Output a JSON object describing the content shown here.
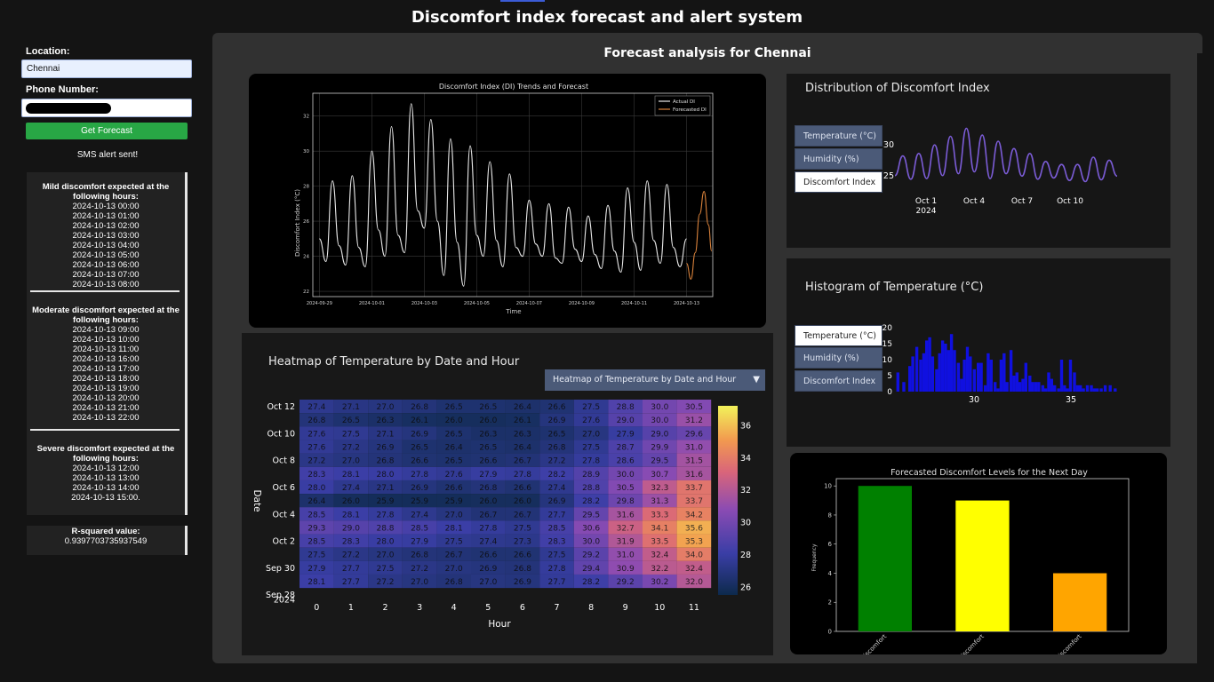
{
  "app_title": "Discomfort index forecast and alert system",
  "sidebar": {
    "location_label": "Location:",
    "location_value": "Chennai",
    "phone_label": "Phone Number:",
    "get_button": "Get Forecast",
    "sms_status": "SMS alert sent!"
  },
  "alerts": [
    {
      "header": "Mild discomfort expected at the following hours:",
      "times": [
        "2024-10-13 00:00",
        "2024-10-13 01:00",
        "2024-10-13 02:00",
        "2024-10-13 03:00",
        "2024-10-13 04:00",
        "2024-10-13 05:00",
        "2024-10-13 06:00",
        "2024-10-13 07:00",
        "2024-10-13 08:00"
      ]
    },
    {
      "header": "Moderate discomfort expected at the following hours:",
      "times": [
        "2024-10-13 09:00",
        "2024-10-13 10:00",
        "2024-10-13 11:00",
        "2024-10-13 16:00",
        "2024-10-13 17:00",
        "2024-10-13 18:00",
        "2024-10-13 19:00",
        "2024-10-13 20:00",
        "2024-10-13 21:00",
        "2024-10-13 22:00"
      ]
    },
    {
      "header": "Severe discomfort expected at the following hours:",
      "times": [
        "2024-10-13 12:00",
        "2024-10-13 13:00",
        "2024-10-13 14:00",
        "2024-10-13 15:00."
      ]
    }
  ],
  "rsquared": {
    "label": "R-squared value:",
    "value": "0.9397703735937549"
  },
  "main": {
    "title": "Forecast analysis for Chennai"
  },
  "line_chart": {
    "title": "Discomfort Index (DI) Trends and Forecast",
    "xlabel": "Time",
    "ylabel": "Discomfort Index (°C)",
    "legend": [
      "Actual DI",
      "Forecasted DI"
    ],
    "x_ticks": [
      "2024-09-29",
      "2024-10-01",
      "2024-10-03",
      "2024-10-05",
      "2024-10-07",
      "2024-10-09",
      "2024-10-11",
      "2024-10-13"
    ],
    "y_ticks": [
      "22",
      "24",
      "26",
      "28",
      "30",
      "32"
    ],
    "colors": {
      "actual": "#e8e8e8",
      "forecast": "#d9823b"
    }
  },
  "distribution": {
    "title": "Distribution of Discomfort Index",
    "tabs": [
      "Temperature (°C)",
      "Humidity (%)",
      "Discomfort Index"
    ],
    "active_tab": 2,
    "x_ticks": [
      "Oct 1",
      "Oct 4",
      "Oct 7",
      "Oct 10"
    ],
    "x_year": "2024",
    "y_ticks": [
      "30",
      "25"
    ],
    "line_color": "#7b5cd6"
  },
  "histogram": {
    "title": "Histogram of Temperature (°C)",
    "tabs": [
      "Temperature (°C)",
      "Humidity (%)",
      "Discomfort Index"
    ],
    "active_tab": 0,
    "x_ticks": [
      "30",
      "35"
    ],
    "y_ticks": [
      "20",
      "15",
      "10",
      "5",
      "0"
    ],
    "bar_color": "#1010e0"
  },
  "heatmap": {
    "title": "Heatmap of Temperature by Date and Hour",
    "dropdown": "Heatmap of Temperature by Date and Hour",
    "xlabel": "Hour",
    "ylabel": "Date",
    "y_tick_labels": [
      "Oct 12",
      "Oct 10",
      "Oct 8",
      "Oct 6",
      "Oct 4",
      "Oct 2",
      "Sep 30",
      "Sep 28"
    ],
    "y_year": "2024",
    "hours": [
      "0",
      "1",
      "2",
      "3",
      "4",
      "5",
      "6",
      "7",
      "8",
      "9",
      "10",
      "11"
    ],
    "colorbar_ticks": [
      "36",
      "34",
      "32",
      "30",
      "28",
      "26"
    ],
    "rows": [
      [
        27.4,
        27.1,
        27.0,
        26.8,
        26.5,
        26.5,
        26.4,
        26.6,
        27.5,
        28.8,
        30.0,
        30.5
      ],
      [
        26.8,
        26.5,
        26.3,
        26.1,
        26.0,
        26.0,
        26.1,
        26.9,
        27.6,
        29.0,
        30.0,
        31.2
      ],
      [
        27.6,
        27.5,
        27.1,
        26.9,
        26.5,
        26.3,
        26.3,
        26.5,
        27.0,
        27.9,
        29.0,
        29.6
      ],
      [
        27.6,
        27.2,
        26.9,
        26.5,
        26.4,
        26.5,
        26.4,
        26.8,
        27.5,
        28.7,
        29.9,
        31.0
      ],
      [
        27.2,
        27.0,
        26.8,
        26.6,
        26.5,
        26.6,
        26.7,
        27.2,
        27.8,
        28.6,
        29.5,
        31.5
      ],
      [
        28.3,
        28.1,
        28.0,
        27.8,
        27.6,
        27.9,
        27.8,
        28.2,
        28.9,
        30.0,
        30.7,
        31.6
      ],
      [
        28.0,
        27.4,
        27.1,
        26.9,
        26.6,
        26.8,
        26.6,
        27.4,
        28.8,
        30.5,
        32.3,
        33.7
      ],
      [
        26.4,
        26.0,
        25.9,
        25.9,
        25.9,
        26.0,
        26.0,
        26.9,
        28.2,
        29.8,
        31.3,
        33.7
      ],
      [
        28.5,
        28.1,
        27.8,
        27.4,
        27.0,
        26.7,
        26.7,
        27.7,
        29.5,
        31.6,
        33.3,
        34.2
      ],
      [
        29.3,
        29.0,
        28.8,
        28.5,
        28.1,
        27.8,
        27.5,
        28.5,
        30.6,
        32.7,
        34.1,
        35.6
      ],
      [
        28.5,
        28.3,
        28.0,
        27.9,
        27.5,
        27.4,
        27.3,
        28.3,
        30.0,
        31.9,
        33.5,
        35.3
      ],
      [
        27.5,
        27.2,
        27.0,
        26.8,
        26.7,
        26.6,
        26.6,
        27.5,
        29.2,
        31.0,
        32.4,
        34.0
      ],
      [
        27.9,
        27.7,
        27.5,
        27.2,
        27.0,
        26.9,
        26.8,
        27.8,
        29.4,
        30.9,
        32.2,
        32.4
      ],
      [
        28.1,
        27.7,
        27.2,
        27.0,
        26.8,
        27.0,
        26.9,
        27.7,
        28.2,
        29.2,
        30.2,
        32.0
      ]
    ]
  },
  "bar_chart": {
    "title": "Forecasted Discomfort Levels for the Next Day",
    "ylabel": "Frequency",
    "categories": [
      "Mild Discomfort",
      "Moderate Discomfort",
      "Severe Discomfort"
    ],
    "tick_labels": [
      "iscomfort",
      "iscomfort",
      "iscomfort"
    ],
    "y_ticks": [
      "10",
      "8",
      "6",
      "4",
      "2",
      "0"
    ],
    "colors": [
      "#008000",
      "#ffff00",
      "#ffa500"
    ]
  },
  "chart_data": [
    {
      "type": "line",
      "title": "Discomfort Index (DI) Trends and Forecast",
      "xlabel": "Time",
      "ylabel": "Discomfort Index (°C)",
      "x_range": [
        "2024-09-29",
        "2024-10-14"
      ],
      "ylim": [
        21.7,
        33.3
      ],
      "grid": true,
      "legend": "top-right",
      "series": [
        {
          "name": "Actual DI",
          "x": [
            "2024-09-29 00:00",
            "2024-09-29 06:00",
            "2024-09-29 12:00",
            "2024-09-29 18:00",
            "2024-09-30 00:00",
            "2024-09-30 06:00",
            "2024-09-30 12:00",
            "2024-09-30 18:00",
            "2024-10-01 00:00",
            "2024-10-01 06:00",
            "2024-10-01 12:00",
            "2024-10-01 18:00",
            "2024-10-02 00:00",
            "2024-10-02 06:00",
            "2024-10-02 12:00",
            "2024-10-02 18:00",
            "2024-10-03 00:00",
            "2024-10-03 06:00",
            "2024-10-03 12:00",
            "2024-10-03 18:00",
            "2024-10-04 00:00",
            "2024-10-04 06:00",
            "2024-10-04 12:00",
            "2024-10-04 18:00",
            "2024-10-05 00:00",
            "2024-10-05 06:00",
            "2024-10-05 12:00",
            "2024-10-05 18:00",
            "2024-10-06 00:00",
            "2024-10-06 06:00",
            "2024-10-06 12:00",
            "2024-10-06 18:00",
            "2024-10-07 00:00",
            "2024-10-07 06:00",
            "2024-10-07 12:00",
            "2024-10-07 18:00",
            "2024-10-08 00:00",
            "2024-10-08 06:00",
            "2024-10-08 12:00",
            "2024-10-08 18:00",
            "2024-10-09 00:00",
            "2024-10-09 06:00",
            "2024-10-09 12:00",
            "2024-10-09 18:00",
            "2024-10-10 00:00",
            "2024-10-10 06:00",
            "2024-10-10 12:00",
            "2024-10-10 18:00",
            "2024-10-11 00:00",
            "2024-10-11 06:00",
            "2024-10-11 12:00",
            "2024-10-11 18:00",
            "2024-10-12 00:00",
            "2024-10-12 06:00",
            "2024-10-12 12:00",
            "2024-10-12 18:00",
            "2024-10-13 00:00"
          ],
          "y": [
            25.0,
            23.7,
            28.3,
            24.6,
            23.5,
            28.6,
            24.5,
            23.4,
            30.0,
            25.5,
            24.0,
            31.4,
            25.2,
            24.2,
            32.7,
            26.6,
            25.6,
            31.8,
            26.0,
            22.9,
            30.7,
            24.8,
            22.3,
            30.3,
            25.2,
            24.0,
            29.4,
            24.9,
            23.4,
            28.7,
            24.5,
            24.0,
            27.2,
            24.7,
            24.0,
            27.0,
            23.9,
            23.6,
            26.8,
            24.4,
            23.7,
            26.3,
            24.1,
            23.3,
            26.9,
            24.3,
            23.1,
            27.9,
            24.8,
            23.2,
            28.3,
            24.9,
            23.6,
            28.1,
            24.5,
            23.4,
            25.0
          ]
        },
        {
          "name": "Forecasted DI",
          "x": [
            "2024-10-13 00:00",
            "2024-10-13 04:00",
            "2024-10-13 08:00",
            "2024-10-13 12:00",
            "2024-10-13 16:00",
            "2024-10-13 20:00",
            "2024-10-13 23:00"
          ],
          "y": [
            23.6,
            22.7,
            24.2,
            26.4,
            27.7,
            25.8,
            24.3
          ]
        }
      ]
    },
    {
      "type": "line",
      "title": "Distribution of Discomfort Index",
      "x_range": [
        "2024-09-29",
        "2024-10-13"
      ],
      "ylim": [
        23.5,
        33.5
      ],
      "series": [
        {
          "name": "Discomfort Index",
          "x": [
            "2024-09-29",
            "2024-09-29 12:00",
            "2024-09-30",
            "2024-09-30 12:00",
            "2024-10-01",
            "2024-10-01 12:00",
            "2024-10-02",
            "2024-10-02 12:00",
            "2024-10-03",
            "2024-10-03 12:00",
            "2024-10-04",
            "2024-10-04 12:00",
            "2024-10-05",
            "2024-10-05 12:00",
            "2024-10-06",
            "2024-10-06 12:00",
            "2024-10-07",
            "2024-10-07 12:00",
            "2024-10-08",
            "2024-10-08 12:00",
            "2024-10-09",
            "2024-10-09 12:00",
            "2024-10-10",
            "2024-10-10 12:00",
            "2024-10-11",
            "2024-10-11 12:00",
            "2024-10-12",
            "2024-10-12 12:00",
            "2024-10-13"
          ],
          "y": [
            25.0,
            28.2,
            24.4,
            28.6,
            24.5,
            30.0,
            25.0,
            31.4,
            25.3,
            32.7,
            25.6,
            31.6,
            24.5,
            30.6,
            25.3,
            29.4,
            24.9,
            28.6,
            24.4,
            27.3,
            24.6,
            26.8,
            24.2,
            26.8,
            24.0,
            28.0,
            24.3,
            27.5,
            24.9
          ]
        }
      ]
    },
    {
      "type": "bar",
      "title": "Histogram of Temperature (°C)",
      "xlim": [
        26,
        37.2
      ],
      "ylim": [
        0,
        20
      ],
      "x": [
        26.15,
        26.45,
        26.75,
        26.9,
        27.1,
        27.3,
        27.45,
        27.6,
        27.75,
        27.9,
        28.1,
        28.25,
        28.4,
        28.55,
        28.7,
        28.85,
        29.0,
        29.2,
        29.35,
        29.5,
        29.65,
        29.8,
        30.0,
        30.2,
        30.35,
        30.55,
        30.7,
        30.85,
        31.05,
        31.2,
        31.35,
        31.5,
        31.65,
        31.85,
        32.0,
        32.15,
        32.3,
        32.45,
        32.6,
        32.8,
        32.95,
        33.1,
        33.25,
        33.45,
        33.6,
        33.75,
        33.9,
        34.05,
        34.25,
        34.4,
        34.55,
        34.7,
        34.85,
        35.05,
        35.2,
        35.35,
        35.5,
        35.7,
        35.9,
        36.05,
        36.2,
        36.4,
        36.6,
        36.85,
        37.1
      ],
      "values": [
        6,
        3,
        8,
        11,
        14,
        10,
        12,
        16,
        17,
        11,
        7,
        12,
        16,
        15,
        13,
        18,
        13,
        9,
        4,
        10,
        14,
        11,
        7,
        9,
        9,
        2,
        12,
        10,
        3,
        1,
        10,
        12,
        3,
        13,
        5,
        6,
        3,
        4,
        9,
        5,
        3,
        3,
        3,
        2,
        1,
        6,
        4,
        2,
        1,
        10,
        2,
        1,
        10,
        6,
        2,
        2,
        1,
        2,
        2,
        1,
        1,
        1,
        2,
        2,
        1
      ]
    },
    {
      "type": "heatmap",
      "title": "Heatmap of Temperature by Date and Hour",
      "xlabel": "Hour",
      "ylabel": "Date",
      "x": [
        0,
        1,
        2,
        3,
        4,
        5,
        6,
        7,
        8,
        9,
        10,
        11
      ],
      "y": [
        "Oct 12",
        "Oct 11",
        "Oct 10",
        "Oct 9",
        "Oct 8",
        "Oct 7",
        "Oct 6",
        "Oct 5",
        "Oct 4",
        "Oct 3",
        "Oct 2",
        "Oct 1",
        "Sep 30",
        "Sep 29"
      ],
      "colorscale_range": [
        25.5,
        37.2
      ],
      "source": "heatmap.rows"
    },
    {
      "type": "bar",
      "title": "Forecasted Discomfort Levels for the Next Day",
      "ylabel": "Frequency",
      "categories": [
        "Mild Discomfort",
        "Moderate Discomfort",
        "Severe Discomfort"
      ],
      "values": [
        10,
        9,
        4
      ],
      "ylim": [
        0,
        10.5
      ]
    }
  ]
}
